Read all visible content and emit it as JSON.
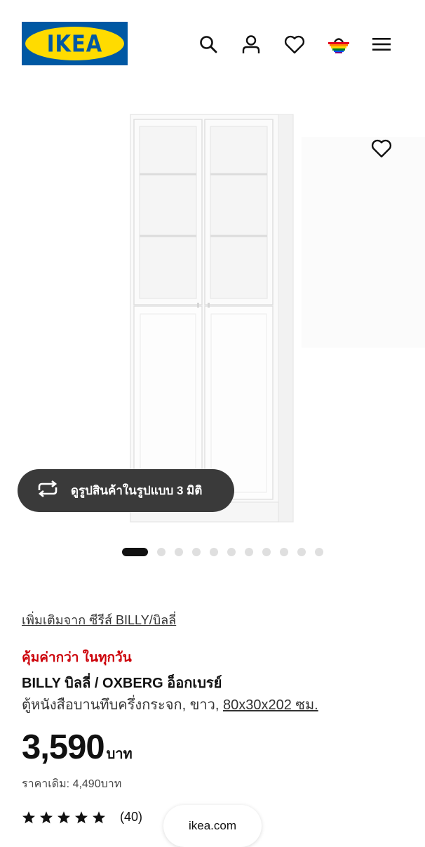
{
  "header": {
    "logo_text": "IKEA",
    "icons": [
      "search-icon",
      "user-icon",
      "heart-icon",
      "basket-icon",
      "menu-icon"
    ]
  },
  "product_image": {
    "view_3d_label": "ดูรูปสินค้าในรูปแบบ 3 มิติ",
    "carousel": {
      "total": 11,
      "active": 1
    }
  },
  "product": {
    "series_link": "เพิ่มเติมจาก ซีรีส์ BILLY/บิลลี่",
    "promo": "คุ้มค่ากว่า ในทุกวัน",
    "name": "BILLY บิลลี่ / OXBERG อ็อกเบรย์",
    "description": "ตู้หนังสือบานทึบครึ่งกระจก, ขาว, ",
    "dimensions": "80x30x202 ซม.",
    "price": "3,590",
    "currency": "บาท",
    "old_price": "ราคาเดิม: 4,490บาท",
    "rating": 5,
    "review_count": "(40)"
  },
  "browser": {
    "domain": "ikea.com"
  },
  "colors": {
    "ikea_blue": "#0058a3",
    "ikea_yellow": "#ffdb00",
    "promo_red": "#cc0008"
  }
}
